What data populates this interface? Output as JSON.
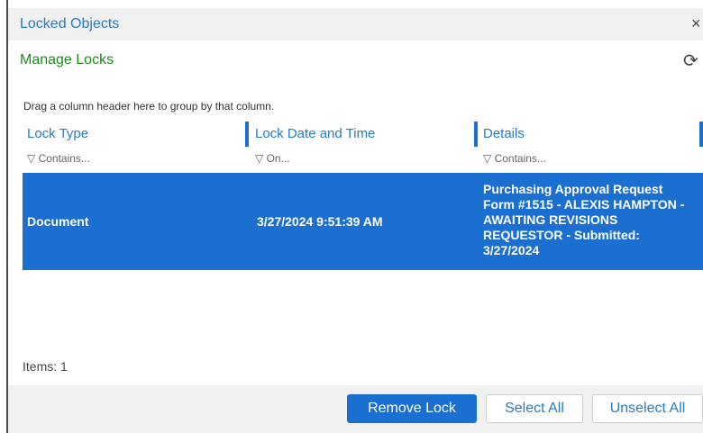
{
  "window": {
    "title": "Locked Objects",
    "close_icon": "×"
  },
  "panel": {
    "subtitle": "Manage Locks",
    "refresh_icon": "⟳"
  },
  "grid": {
    "group_hint": "Drag a column header here to group by that column.",
    "columns": [
      {
        "label": "Lock Type",
        "filter": "Contains..."
      },
      {
        "label": "Lock Date and Time",
        "filter": "On..."
      },
      {
        "label": "Details",
        "filter": "Contains..."
      }
    ],
    "rows": [
      {
        "lock_type": "Document",
        "lock_date": "3/27/2024 9:51:39 AM",
        "details": "Purchasing Approval Request Form #1515 - ALEXIS HAMPTON - AWAITING REVISIONS REQUESTOR - Submitted: 3/27/2024"
      }
    ],
    "items_label": "Items: 1"
  },
  "footer": {
    "remove_lock": "Remove Lock",
    "select_all": "Select All",
    "unselect_all": "Unselect All"
  },
  "colors": {
    "accent": "#1a6fd0",
    "title": "#2b7bc4",
    "subtitle": "#1e8a1e"
  }
}
